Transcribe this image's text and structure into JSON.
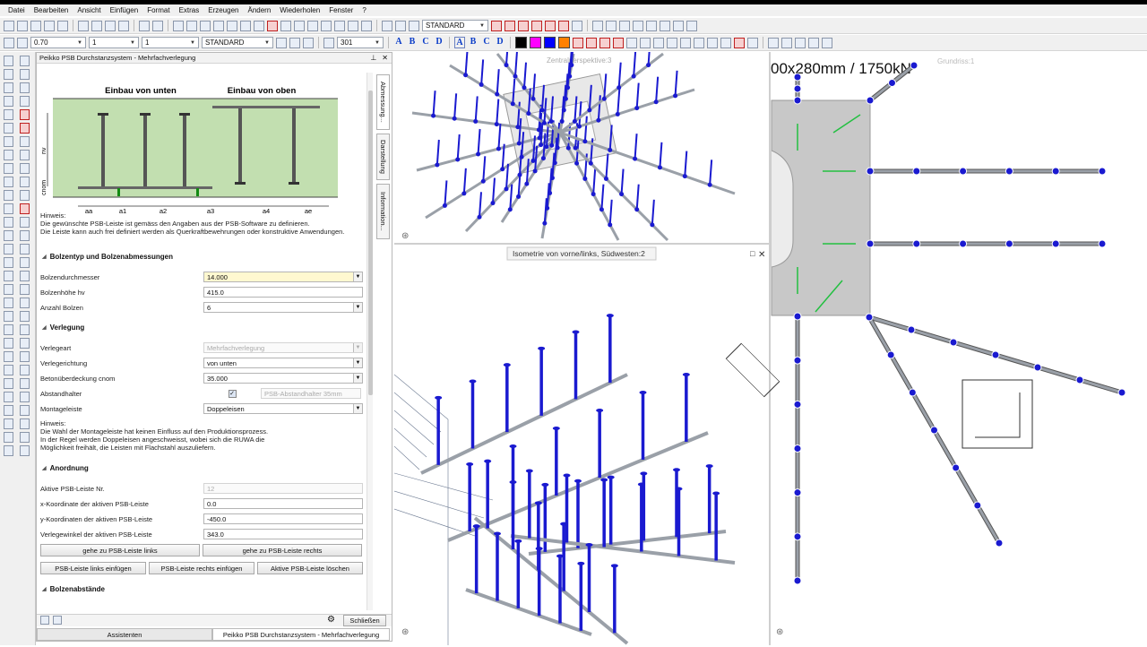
{
  "menu": [
    "Datei",
    "Bearbeiten",
    "Ansicht",
    "Einfügen",
    "Format",
    "Extras",
    "Erzeugen",
    "Ändern",
    "Wiederholen",
    "Fenster",
    "?"
  ],
  "toolbar": {
    "pen_thickness": "0.70",
    "line_type": "1",
    "color_index": "1",
    "layer": "STANDARD",
    "layer_top": "STANDARD",
    "pattern_number": "301",
    "text_letters": [
      "A",
      "B",
      "C",
      "D"
    ],
    "text_letters2": [
      "A",
      "B",
      "C",
      "D"
    ],
    "colors": [
      "#000000",
      "#ff00ff",
      "#0000ff",
      "#ff8000"
    ]
  },
  "panel": {
    "title": "Peikko PSB Durchstanzsystem - Mehrfachverlegung",
    "side_tabs": [
      "Abmessung...",
      "Darstellung",
      "Information..."
    ],
    "diagram": {
      "title_left": "Einbau von unten",
      "title_right": "Einbau von oben",
      "label_hv": "hv",
      "label_cnom": "cnom",
      "dims": [
        "aa",
        "a1",
        "a2",
        "a3",
        "a4",
        "ae"
      ]
    },
    "hint1_title": "Hinweis:",
    "hint1_lines": [
      "Die gewünschte PSB-Leiste ist gemäss den Angaben aus der PSB-Software zu definieren.",
      "Die Leiste kann auch frei definiert werden als Querkraftbewehrungen oder konstruktive Anwendungen."
    ],
    "section1": "Bolzentyp und Bolzenabmessungen",
    "bolzendurchmesser_label": "Bolzendurchmesser",
    "bolzendurchmesser_value": "14.000",
    "bolzenhoehe_label": "Bolzenhöhe hv",
    "bolzenhoehe_value": "415.0",
    "anzahl_label": "Anzahl Bolzen",
    "anzahl_value": "6",
    "section2": "Verlegung",
    "verlegeart_label": "Verlegeart",
    "verlegeart_value": "Mehrfachverlegung",
    "verlegerichtung_label": "Verlegerichtung",
    "verlegerichtung_value": "von unten",
    "beton_label": "Betonüberdeckung cnom",
    "beton_value": "35.000",
    "abstandhalter_label": "Abstandhalter",
    "abstandhalter_value": "PSB-Abstandhalter 35mm",
    "montage_label": "Montageleiste",
    "montage_value": "Doppeleisen",
    "hint2_title": "Hinweis:",
    "hint2_lines": [
      "Die Wahl der Montageleiste hat keinen Einfluss auf den Produktionsprozess.",
      "In der Regel werden Doppeleisen angeschweisst, wobei sich die RUWA die",
      "Möglichkeit freihält, die Leisten mit Flachstahl auszuliefern."
    ],
    "section3": "Anordnung",
    "aktive_label": "Aktive PSB-Leiste Nr.",
    "aktive_value": "12",
    "x_label": "x-Koordinate der aktiven PSB-Leiste",
    "x_value": "0.0",
    "y_label": "y-Koordinaten der aktiven PSB-Leiste",
    "y_value": "-450.0",
    "winkel_label": "Verlegewinkel der aktiven PSB-Leiste",
    "winkel_value": "343.0",
    "btn_links": "gehe zu PSB-Leiste links",
    "btn_rechts": "gehe zu PSB-Leiste rechts",
    "btn_ins_links": "PSB-Leiste links einfügen",
    "btn_ins_rechts": "PSB-Leiste rechts einfügen",
    "btn_delete": "Aktive PSB-Leiste löschen",
    "section4": "Bolzenabstände",
    "close_button": "Schließen",
    "tab_assist": "Assistenten",
    "tab_active": "Peikko PSB Durchstanzsystem - Mehrfachverlegung"
  },
  "views": {
    "top_left_label": "Zentralperspektive:3",
    "bottom_label": "Isometrie von vorne/links, Südwesten:2",
    "right_label": "Grundriss:1",
    "right_overlay": "00x280mm / 1750kN"
  },
  "colors": {
    "stud": "#1a1ad0",
    "bar": "#9aa0a8",
    "arrow": "#22c040",
    "slab": "#c8c8c8"
  }
}
